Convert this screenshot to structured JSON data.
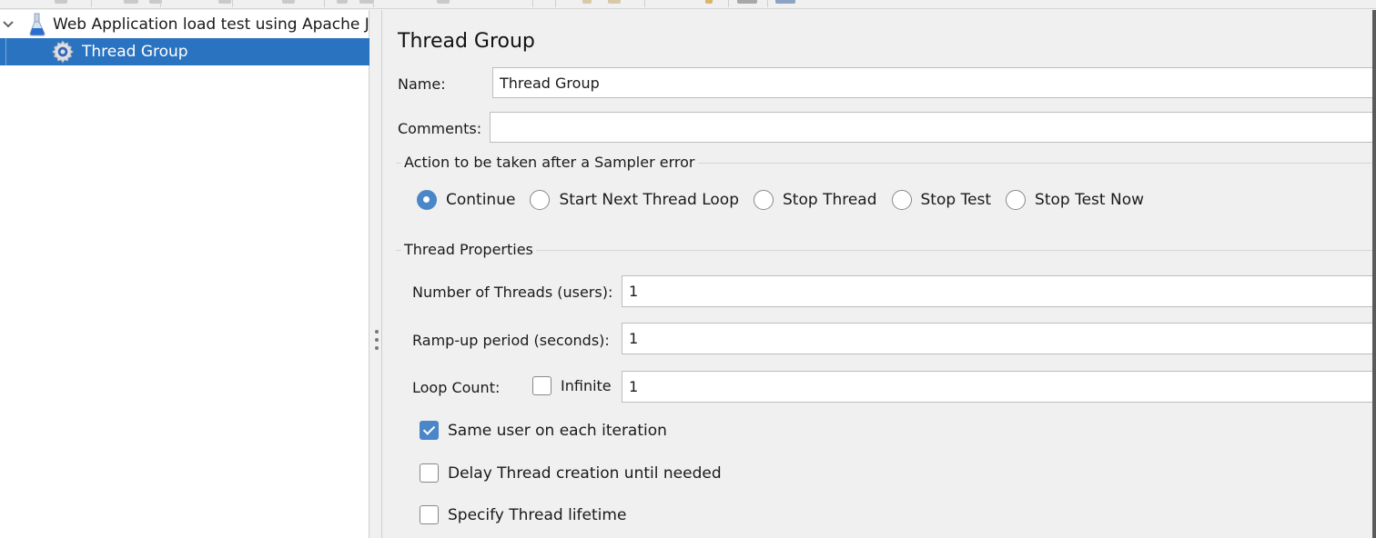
{
  "tree": {
    "root": {
      "label": "Web Application load test using Apache JM",
      "icon": "flask-icon",
      "expanded": true
    },
    "children": [
      {
        "label": "Thread Group",
        "icon": "gear-icon",
        "selected": true
      }
    ]
  },
  "panel": {
    "title": "Thread Group",
    "name_label": "Name:",
    "name_value": "Thread Group",
    "comments_label": "Comments:",
    "comments_value": "",
    "sampler_error": {
      "title": "Action to be taken after a Sampler error",
      "options": [
        {
          "label": "Continue",
          "checked": true
        },
        {
          "label": "Start Next Thread Loop",
          "checked": false
        },
        {
          "label": "Stop Thread",
          "checked": false
        },
        {
          "label": "Stop Test",
          "checked": false
        },
        {
          "label": "Stop Test Now",
          "checked": false
        }
      ]
    },
    "thread_properties": {
      "title": "Thread Properties",
      "threads_label": "Number of Threads (users):",
      "threads_value": "1",
      "rampup_label": "Ramp-up period (seconds):",
      "rampup_value": "1",
      "loop_label": "Loop Count:",
      "infinite_label": "Infinite",
      "infinite_checked": false,
      "loop_value": "1",
      "same_user_label": "Same user on each iteration",
      "same_user_checked": true,
      "delay_label": "Delay Thread creation until needed",
      "delay_checked": false,
      "lifetime_label": "Specify Thread lifetime",
      "lifetime_checked": false
    }
  },
  "colors": {
    "selection": "#2a73c0",
    "accent": "#4a86c8"
  }
}
